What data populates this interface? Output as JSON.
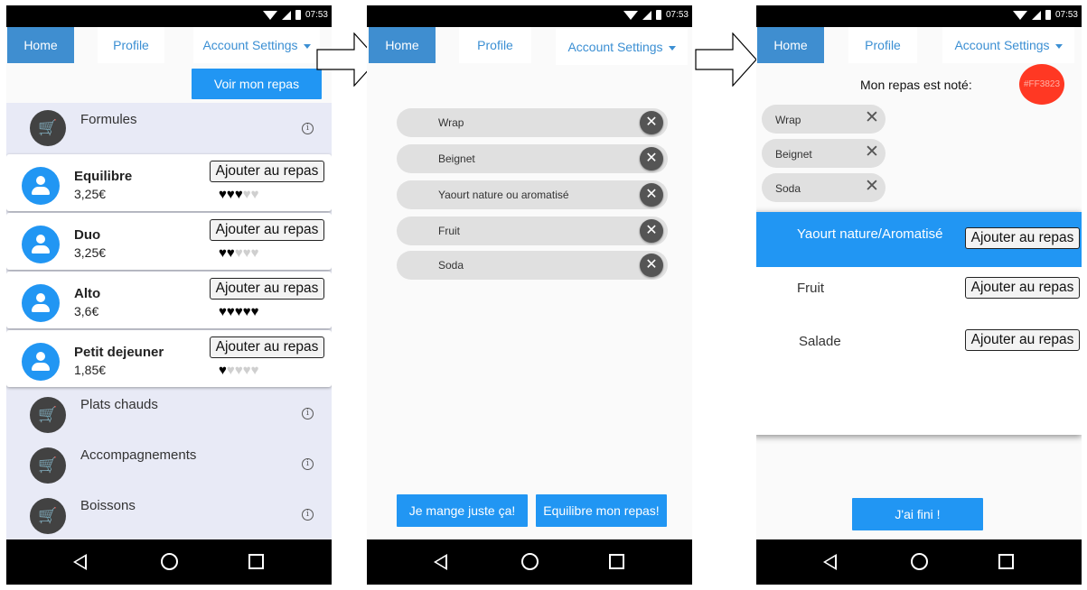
{
  "status_bar": {
    "time": "07:53"
  },
  "tabs": {
    "home": "Home",
    "profile": "Profile",
    "account_settings": "Account Settings"
  },
  "screen1": {
    "top_button": "Voir mon repas",
    "categories": [
      "Formules",
      "Plats chauds",
      "Accompagnements",
      "Boissons"
    ],
    "formules": [
      {
        "name": "Equilibre",
        "price": "3,25€",
        "rating": 3,
        "button": "Ajouter au repas"
      },
      {
        "name": "Duo",
        "price": "3,25€",
        "rating": 2,
        "button": "Ajouter au repas"
      },
      {
        "name": "Alto",
        "price": "3,6€",
        "rating": 5,
        "button": "Ajouter au repas"
      },
      {
        "name": "Petit dejeuner",
        "price": "1,85€",
        "rating": 1,
        "button": "Ajouter au repas"
      }
    ],
    "rating_max": 5
  },
  "screen2": {
    "items": [
      "Wrap",
      "Beignet",
      "Yaourt nature ou aromatisé",
      "Fruit",
      "Soda"
    ],
    "button_just_this": "Je mange juste ça!",
    "button_balance": "Equilibre mon repas!"
  },
  "screen3": {
    "note_label": "Mon repas est noté:",
    "note_value": "#FF3823",
    "note_color": "#ff3823",
    "items": [
      "Wrap",
      "Beignet",
      "Soda"
    ],
    "suggestions": [
      {
        "label": "Yaourt nature/Aromatisé",
        "button": "Ajouter au repas",
        "selected": true
      },
      {
        "label": "Fruit",
        "button": "Ajouter au repas",
        "selected": false
      },
      {
        "label": "Salade",
        "button": "Ajouter au repas",
        "selected": false
      }
    ],
    "done_button": "J'ai fini !"
  },
  "colors": {
    "accent": "#2196f3",
    "tab_active": "#3f8ed0",
    "category_bg": "#e8eaf6",
    "chip_bg": "#e0e0e0"
  }
}
